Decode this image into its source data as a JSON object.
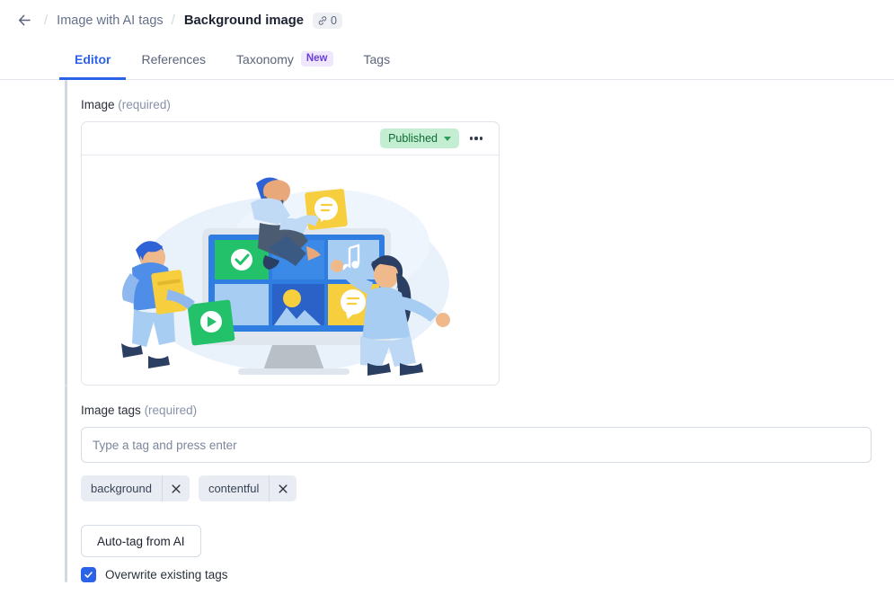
{
  "breadcrumb": {
    "back_icon": "arrow-left-icon",
    "separator": "/",
    "parent_label": "Image with AI tags",
    "current_label": "Background image",
    "link_icon": "link-icon",
    "link_count": "0"
  },
  "tabs": [
    {
      "label": "Editor",
      "badge": null,
      "active": true
    },
    {
      "label": "References",
      "badge": null,
      "active": false
    },
    {
      "label": "Taxonomy",
      "badge": "New",
      "active": false
    },
    {
      "label": "Tags",
      "badge": null,
      "active": false
    }
  ],
  "image_field": {
    "label": "Image",
    "required_text": "(required)",
    "status": "Published",
    "status_color": "#c4eed2",
    "status_text_color": "#0d6b33",
    "menu_icon": "ellipsis-icon",
    "illustration": "people-around-computer-media-illustration"
  },
  "tags_field": {
    "label": "Image tags",
    "required_text": "(required)",
    "input_value": "",
    "input_placeholder": "Type a tag and press enter",
    "chips": [
      {
        "label": "background",
        "remove_icon": "close-icon"
      },
      {
        "label": "contentful",
        "remove_icon": "close-icon"
      }
    ],
    "autotag_button": "Auto-tag from AI",
    "overwrite_checkbox": {
      "label": "Overwrite existing tags",
      "checked": true,
      "color": "#2a62e8"
    }
  },
  "theme": {
    "accent": "#2a62e8",
    "badge_purple_bg": "#efe7fd",
    "badge_purple_text": "#6c3fd6"
  }
}
